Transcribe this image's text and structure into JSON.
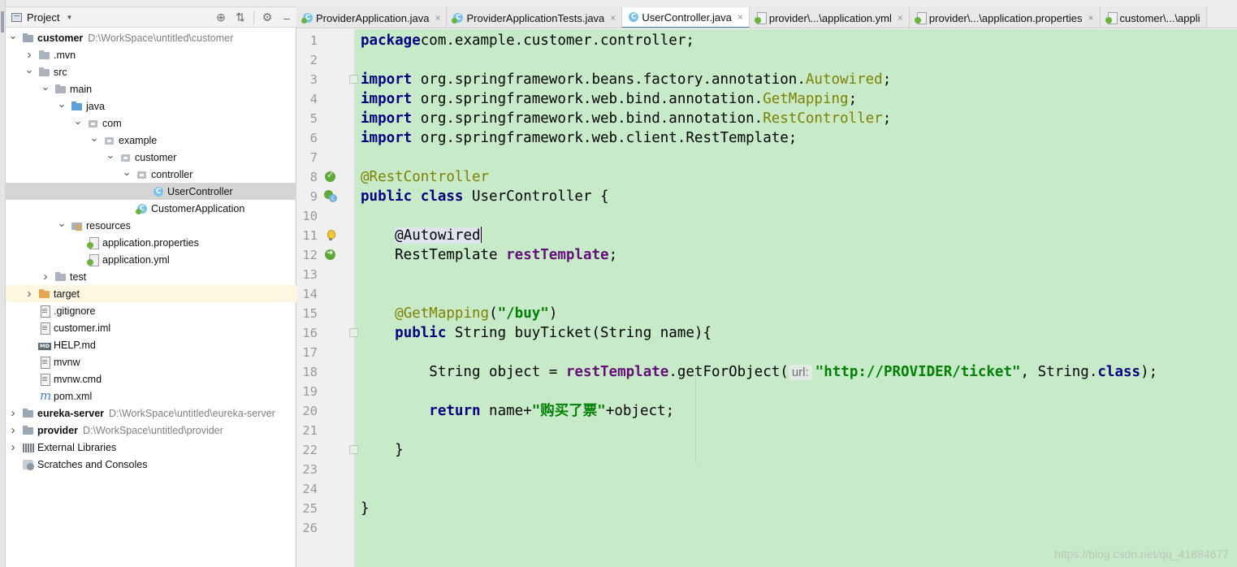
{
  "project_panel": {
    "title": "Project",
    "tree": [
      {
        "label": "customer",
        "path": "D:\\WorkSpace\\untitled\\customer",
        "bold": true,
        "depth": 0,
        "arrow": "open",
        "icon": "module-icon"
      },
      {
        "label": ".mvn",
        "depth": 1,
        "arrow": "closed",
        "icon": "folder-icon"
      },
      {
        "label": "src",
        "depth": 1,
        "arrow": "open",
        "icon": "folder-icon"
      },
      {
        "label": "main",
        "depth": 2,
        "arrow": "open",
        "icon": "folder-icon"
      },
      {
        "label": "java",
        "depth": 3,
        "arrow": "open",
        "icon": "source-folder-icon"
      },
      {
        "label": "com",
        "depth": 4,
        "arrow": "open",
        "icon": "package-icon"
      },
      {
        "label": "example",
        "depth": 5,
        "arrow": "open",
        "icon": "package-icon"
      },
      {
        "label": "customer",
        "depth": 6,
        "arrow": "open",
        "icon": "package-icon"
      },
      {
        "label": "controller",
        "depth": 7,
        "arrow": "open",
        "icon": "package-icon"
      },
      {
        "label": "UserController",
        "depth": 8,
        "arrow": "none",
        "icon": "class-icon",
        "selected": true
      },
      {
        "label": "CustomerApplication",
        "depth": 7,
        "arrow": "none",
        "icon": "spring-class-icon"
      },
      {
        "label": "resources",
        "depth": 3,
        "arrow": "open",
        "icon": "resources-folder-icon"
      },
      {
        "label": "application.properties",
        "depth": 4,
        "arrow": "none",
        "icon": "spring-config-icon"
      },
      {
        "label": "application.yml",
        "depth": 4,
        "arrow": "none",
        "icon": "spring-config-icon"
      },
      {
        "label": "test",
        "depth": 2,
        "arrow": "closed",
        "icon": "folder-icon"
      },
      {
        "label": "target",
        "depth": 1,
        "arrow": "closed",
        "icon": "excluded-folder-icon",
        "highlight": true
      },
      {
        "label": ".gitignore",
        "depth": 1,
        "arrow": "none",
        "icon": "file-icon"
      },
      {
        "label": "customer.iml",
        "depth": 1,
        "arrow": "none",
        "icon": "file-icon"
      },
      {
        "label": "HELP.md",
        "depth": 1,
        "arrow": "none",
        "icon": "markdown-icon"
      },
      {
        "label": "mvnw",
        "depth": 1,
        "arrow": "none",
        "icon": "file-icon"
      },
      {
        "label": "mvnw.cmd",
        "depth": 1,
        "arrow": "none",
        "icon": "file-icon"
      },
      {
        "label": "pom.xml",
        "depth": 1,
        "arrow": "none",
        "icon": "maven-icon"
      },
      {
        "label": "eureka-server",
        "path": "D:\\WorkSpace\\untitled\\eureka-server",
        "bold": true,
        "depth": 0,
        "arrow": "closed",
        "icon": "module-icon"
      },
      {
        "label": "provider",
        "path": "D:\\WorkSpace\\untitled\\provider",
        "bold": true,
        "depth": 0,
        "arrow": "closed",
        "icon": "module-icon"
      },
      {
        "label": "External Libraries",
        "depth": 0,
        "arrow": "closed",
        "icon": "libraries-icon"
      },
      {
        "label": "Scratches and Consoles",
        "depth": 0,
        "arrow": "none",
        "icon": "scratches-icon"
      }
    ]
  },
  "tabs": [
    {
      "label": "ProviderApplication.java",
      "icon": "spring-class-icon",
      "active": false
    },
    {
      "label": "ProviderApplicationTests.java",
      "icon": "spring-class-icon",
      "active": false
    },
    {
      "label": "UserController.java",
      "icon": "class-icon",
      "active": true
    },
    {
      "label": "provider\\...\\application.yml",
      "icon": "spring-config-icon",
      "active": false
    },
    {
      "label": "provider\\...\\application.properties",
      "icon": "spring-config-icon",
      "active": false
    },
    {
      "label": "customer\\...\\appli",
      "icon": "spring-config-icon",
      "active": false,
      "truncated": true
    }
  ],
  "editor": {
    "current_line": 11,
    "lines": [
      {
        "n": "1",
        "tokens": [
          [
            "kw",
            "package"
          ],
          [
            "",
            "com.example.customer.controller;"
          ]
        ]
      },
      {
        "n": "2",
        "tokens": []
      },
      {
        "n": "3",
        "tokens": [
          [
            "kw",
            "import"
          ],
          [
            "",
            " org.springframework.beans.factory.annotation."
          ],
          [
            "anno",
            "Autowired"
          ],
          [
            "",
            ";"
          ]
        ]
      },
      {
        "n": "4",
        "tokens": [
          [
            "kw",
            "import"
          ],
          [
            "",
            " org.springframework.web.bind.annotation."
          ],
          [
            "anno",
            "GetMapping"
          ],
          [
            "",
            ";"
          ]
        ]
      },
      {
        "n": "5",
        "tokens": [
          [
            "kw",
            "import"
          ],
          [
            "",
            " org.springframework.web.bind.annotation."
          ],
          [
            "anno",
            "RestController"
          ],
          [
            "",
            ";"
          ]
        ]
      },
      {
        "n": "6",
        "tokens": [
          [
            "kw",
            "import"
          ],
          [
            "",
            " org.springframework.web.client.RestTemplate;"
          ]
        ]
      },
      {
        "n": "7",
        "tokens": []
      },
      {
        "n": "8",
        "tokens": [
          [
            "anno",
            "@RestController"
          ]
        ]
      },
      {
        "n": "9",
        "tokens": [
          [
            "kw",
            "public class"
          ],
          [
            "",
            " UserController {"
          ]
        ]
      },
      {
        "n": "10",
        "tokens": []
      },
      {
        "n": "11",
        "tokens": [
          [
            "",
            "    "
          ],
          [
            "anno-hl",
            "@Autowired"
          ],
          [
            "caret",
            ""
          ]
        ]
      },
      {
        "n": "12",
        "tokens": [
          [
            "",
            "    RestTemplate "
          ],
          [
            "field",
            "restTemplate"
          ],
          [
            "",
            ";"
          ]
        ]
      },
      {
        "n": "13",
        "tokens": []
      },
      {
        "n": "14",
        "tokens": []
      },
      {
        "n": "15",
        "tokens": [
          [
            "",
            "    "
          ],
          [
            "anno",
            "@GetMapping"
          ],
          [
            "",
            "("
          ],
          [
            "str",
            "\"/buy\""
          ],
          [
            "",
            ")"
          ]
        ]
      },
      {
        "n": "16",
        "tokens": [
          [
            "",
            "    "
          ],
          [
            "kw",
            "public"
          ],
          [
            "",
            " String buyTicket(String name){"
          ]
        ]
      },
      {
        "n": "17",
        "tokens": []
      },
      {
        "n": "18",
        "tokens": [
          [
            "",
            "        String object = "
          ],
          [
            "field",
            "restTemplate"
          ],
          [
            "",
            ".getForObject("
          ],
          [
            "hint",
            "url:"
          ],
          [
            "str",
            "\"http://PROVIDER/ticket\""
          ],
          [
            "",
            ", String."
          ],
          [
            "kw",
            "class"
          ],
          [
            "",
            ");"
          ]
        ]
      },
      {
        "n": "19",
        "tokens": []
      },
      {
        "n": "20",
        "tokens": [
          [
            "",
            "        "
          ],
          [
            "kw",
            "return"
          ],
          [
            "",
            " name+"
          ],
          [
            "str",
            "\"购买了票\""
          ],
          [
            "",
            "+object;"
          ]
        ]
      },
      {
        "n": "21",
        "tokens": []
      },
      {
        "n": "22",
        "tokens": [
          [
            "",
            "    }"
          ]
        ]
      },
      {
        "n": "23",
        "tokens": []
      },
      {
        "n": "24",
        "tokens": []
      },
      {
        "n": "25",
        "tokens": [
          [
            "",
            "}"
          ]
        ]
      },
      {
        "n": "26",
        "tokens": []
      }
    ]
  },
  "watermark": "https://blog.csdn.net/qq_41884677",
  "colors": {
    "code_background": "#c7ebc9",
    "keyword": "#000080",
    "annotation": "#808000",
    "string": "#008000",
    "field": "#660e7a",
    "current_line": "#fdf8df"
  }
}
